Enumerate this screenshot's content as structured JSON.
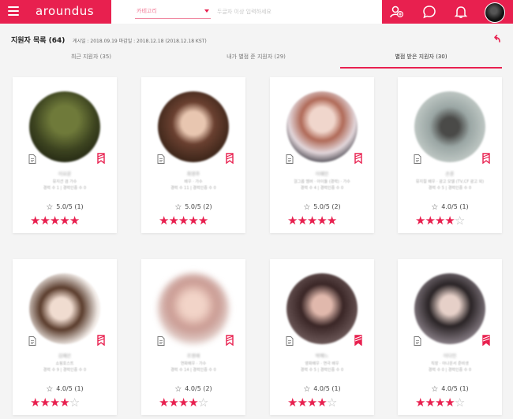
{
  "app": {
    "logo": "aroundus"
  },
  "header": {
    "category_placeholder": "카테고리",
    "search_placeholder": "두글자 이상 입력하세요",
    "icons": [
      "menu-icon",
      "user-add-icon",
      "chat-icon",
      "bell-icon",
      "profile-avatar"
    ]
  },
  "page": {
    "title": "지원자 목록 (64)",
    "dates": "게시일 : 2018.09.19    마감일 : 2018.12.18 (2018.12.18 KST)"
  },
  "tabs": [
    {
      "label": "최근 지원자 (35)",
      "active": false
    },
    {
      "label": "내가 별점 준 지원자 (29)",
      "active": false
    },
    {
      "label": "별점 받은 지원자 (30)",
      "active": true
    }
  ],
  "colors": {
    "accent": "#e8204f"
  },
  "applicants": [
    {
      "name": "이요윤",
      "meta1": "뮤지션 겸 가수",
      "meta2": "경력 수 1 | 경력인증 수 0",
      "rating": "5.0/5 (1)",
      "stars": 5
    },
    {
      "name": "최영주",
      "meta1": "배우 · 가수",
      "meta2": "경력 수 11 | 경력인증 수 0",
      "rating": "5.0/5 (2)",
      "stars": 5
    },
    {
      "name": "이혜민",
      "meta1": "걸그룹 멤버 · 아이돌 (경력) · 가수",
      "meta2": "경력 수 4 | 경력인증 수 0",
      "rating": "5.0/5 (2)",
      "stars": 5
    },
    {
      "name": "손훈",
      "meta1": "뮤지컬 배우 · 광고 모델 (TV,CF 광고 외)",
      "meta2": "경력 수 5 | 경력인증 수 0",
      "rating": "4.0/5 (1)",
      "stars": 4
    },
    {
      "name": "김혜은",
      "meta1": "쇼핑호스트",
      "meta2": "경력 수 9 | 경력인증 수 0",
      "rating": "4.0/5 (1)",
      "stars": 4
    },
    {
      "name": "조영재",
      "meta1": "연화배우 · 가수",
      "meta2": "경력 수 14 | 경력인증 수 0",
      "rating": "4.0/5 (2)",
      "stars": 4
    },
    {
      "name": "박예느",
      "meta1": "영화배우 · 연극 배우",
      "meta2": "경력 수 5 | 경력인증 수 0",
      "rating": "4.0/5 (1)",
      "stars": 4
    },
    {
      "name": "이다인",
      "meta1": "직장 · 아나운서 준비생",
      "meta2": "경력 수 0 | 경력인증 수 0",
      "rating": "4.0/5 (1)",
      "stars": 4
    }
  ]
}
